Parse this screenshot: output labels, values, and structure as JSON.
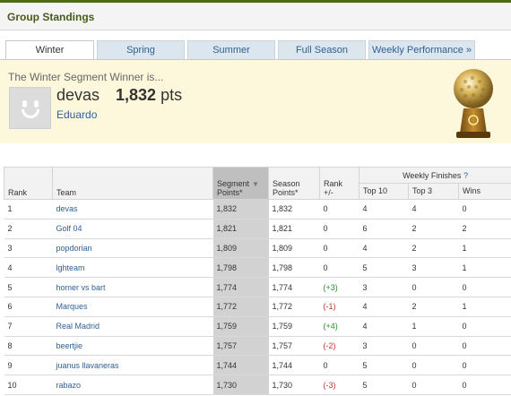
{
  "header": {
    "title": "Group Standings"
  },
  "tabs": [
    {
      "label": "Winter",
      "active": true
    },
    {
      "label": "Spring"
    },
    {
      "label": "Summer"
    },
    {
      "label": "Full Season"
    },
    {
      "label": "Weekly Performance »"
    }
  ],
  "winner": {
    "caption": "The Winter Segment Winner is...",
    "team": "devas",
    "points": "1,832",
    "points_unit": "pts",
    "user": "Eduardo"
  },
  "table": {
    "headers": {
      "rank": "Rank",
      "team": "Team",
      "segment_points_1": "Segment",
      "segment_points_2": "Points*",
      "season_points_1": "Season",
      "season_points_2": "Points*",
      "rank_change_1": "Rank",
      "rank_change_2": "+/-",
      "weekly": "Weekly Finishes",
      "weekly_help": "?",
      "top10": "Top 10",
      "top3": "Top 3",
      "wins": "Wins"
    },
    "rows": [
      {
        "rank": "1",
        "team": "devas",
        "segment": "1,832",
        "season": "1,832",
        "change": "0",
        "top10": "4",
        "top3": "4",
        "wins": "0"
      },
      {
        "rank": "2",
        "team": "Golf 04",
        "segment": "1,821",
        "season": "1,821",
        "change": "0",
        "top10": "6",
        "top3": "2",
        "wins": "2"
      },
      {
        "rank": "3",
        "team": "popdorian",
        "segment": "1,809",
        "season": "1,809",
        "change": "0",
        "top10": "4",
        "top3": "2",
        "wins": "1"
      },
      {
        "rank": "4",
        "team": "lghteam",
        "segment": "1,798",
        "season": "1,798",
        "change": "0",
        "top10": "5",
        "top3": "3",
        "wins": "1"
      },
      {
        "rank": "5",
        "team": "homer vs bart",
        "segment": "1,774",
        "season": "1,774",
        "change": "(+3)",
        "top10": "3",
        "top3": "0",
        "wins": "0"
      },
      {
        "rank": "6",
        "team": "Marques",
        "segment": "1,772",
        "season": "1,772",
        "change": "(-1)",
        "top10": "4",
        "top3": "2",
        "wins": "1"
      },
      {
        "rank": "7",
        "team": "Real Madrid",
        "segment": "1,759",
        "season": "1,759",
        "change": "(+4)",
        "top10": "4",
        "top3": "1",
        "wins": "0"
      },
      {
        "rank": "8",
        "team": "beertjie",
        "segment": "1,757",
        "season": "1,757",
        "change": "(-2)",
        "top10": "3",
        "top3": "0",
        "wins": "0"
      },
      {
        "rank": "9",
        "team": "juanus llavaneras",
        "segment": "1,744",
        "season": "1,744",
        "change": "0",
        "top10": "5",
        "top3": "0",
        "wins": "0"
      },
      {
        "rank": "10",
        "team": "rabazo",
        "segment": "1,730",
        "season": "1,730",
        "change": "(-3)",
        "top10": "5",
        "top3": "0",
        "wins": "0"
      }
    ]
  },
  "colors": {
    "brand_line": "#4e6b12",
    "header_title": "#4a5a1e",
    "link": "#2f5f93",
    "winner_bg": "#fdf8dc",
    "rank_up": "#2e8b2e",
    "rank_down": "#c0392b",
    "sorted_column": "#d2d2d2"
  },
  "icons": {
    "avatar": "default-smiley-avatar",
    "trophy": "golf-ball-trophy-icon",
    "sort": "sort-desc-icon"
  }
}
